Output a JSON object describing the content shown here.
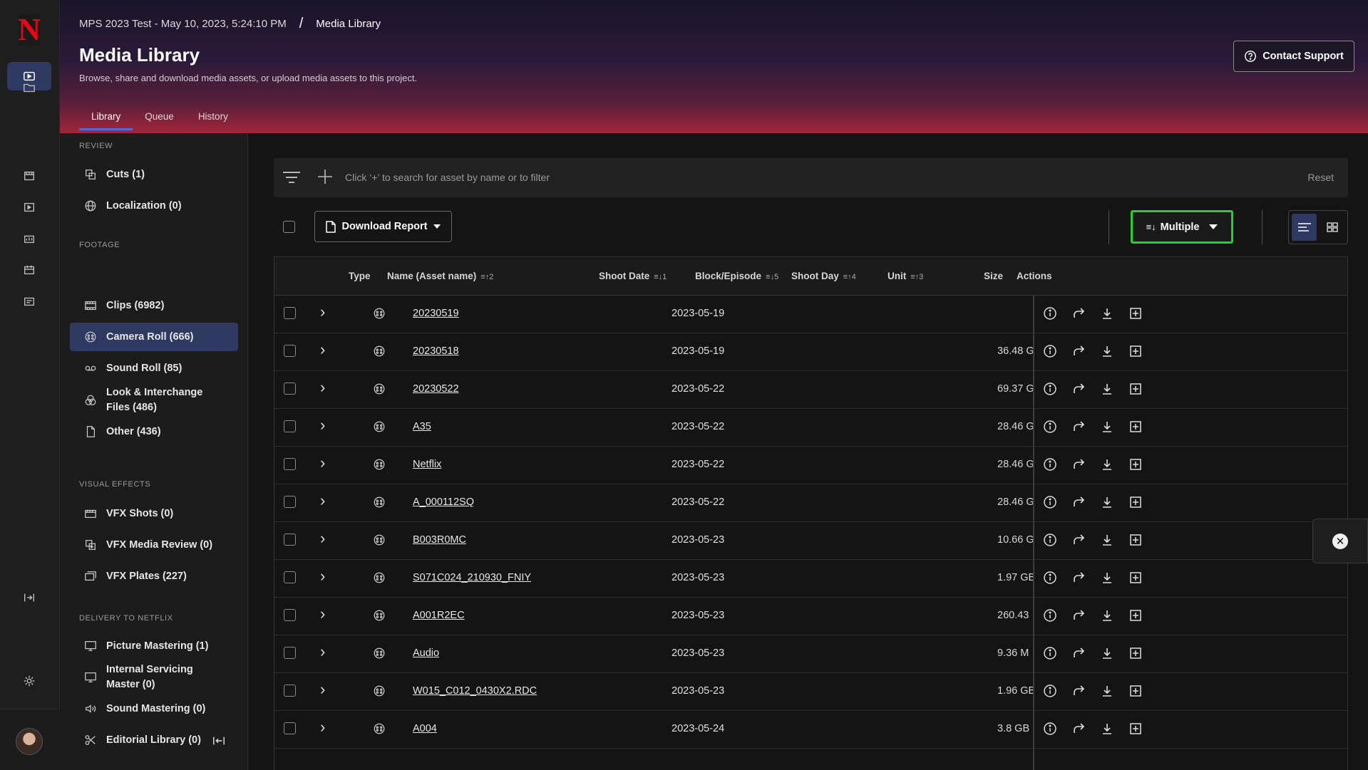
{
  "header": {
    "breadcrumb_project": "MPS 2023 Test - May 10, 2023, 5:24:10 PM",
    "breadcrumb_separator": "/",
    "breadcrumb_current": "Media Library",
    "title": "Media Library",
    "subtitle": "Browse, share and download media assets, or upload media assets to this project.",
    "contact_label": "Contact Support",
    "tabs": [
      {
        "label": "Library",
        "active": true
      },
      {
        "label": "Queue",
        "active": false
      },
      {
        "label": "History",
        "active": false
      }
    ]
  },
  "sidebar": {
    "sections": {
      "review": "REVIEW",
      "footage": "FOOTAGE",
      "vfx": "VISUAL EFFECTS",
      "delivery": "DELIVERY TO NETFLIX"
    },
    "items": [
      {
        "label": "Cuts (1)",
        "icon": "cuts-icon"
      },
      {
        "label": "Localization (0)",
        "icon": "globe-icon"
      },
      {
        "label": "Clips (6982)",
        "icon": "film-icon"
      },
      {
        "label": "Camera Roll (666)",
        "icon": "camera-roll-icon",
        "active": true
      },
      {
        "label": "Sound Roll (85)",
        "icon": "tape-icon"
      },
      {
        "label": "Look & Interchange Files (486)",
        "icon": "color-wheel-icon"
      },
      {
        "label": "Other (436)",
        "icon": "file-icon"
      },
      {
        "label": "VFX Shots (0)",
        "icon": "vfx-icon"
      },
      {
        "label": "VFX Media Review (0)",
        "icon": "review-icon"
      },
      {
        "label": "VFX Plates (227)",
        "icon": "plates-icon"
      },
      {
        "label": "Picture Mastering (1)",
        "icon": "monitor-icon"
      },
      {
        "label": "Internal Servicing Master (0)",
        "icon": "monitor-icon"
      },
      {
        "label": "Sound Mastering (0)",
        "icon": "speaker-icon"
      },
      {
        "label": "Editorial Library (0)",
        "icon": "scissors-icon"
      }
    ]
  },
  "search": {
    "placeholder": "Click ‘+’ to search for asset by name or to filter",
    "reset_label": "Reset"
  },
  "toolbar": {
    "download_label": "Download Report",
    "sort_label": "Multiple"
  },
  "table": {
    "columns": [
      {
        "label": "Type",
        "sort": ""
      },
      {
        "label": "Name (Asset name)",
        "sort": "≡↑2"
      },
      {
        "label": "Shoot Date",
        "sort": "≡↓1"
      },
      {
        "label": "Block/Episode",
        "sort": "≡↓5"
      },
      {
        "label": "Shoot Day",
        "sort": "≡↑4"
      },
      {
        "label": "Unit",
        "sort": "≡↑3"
      },
      {
        "label": "Size",
        "sort": ""
      },
      {
        "label": "Actions",
        "sort": ""
      }
    ],
    "rows": [
      {
        "name": "20230519",
        "date": "2023-05-19",
        "size": ""
      },
      {
        "name": "20230518",
        "date": "2023-05-19",
        "size": "36.48 G"
      },
      {
        "name": "20230522",
        "date": "2023-05-22",
        "size": "69.37 G"
      },
      {
        "name": "A35",
        "date": "2023-05-22",
        "size": "28.46 G"
      },
      {
        "name": "Netflix",
        "date": "2023-05-22",
        "size": "28.46 G"
      },
      {
        "name": "A_000112SQ",
        "date": "2023-05-22",
        "size": "28.46 G"
      },
      {
        "name": "B003R0MC",
        "date": "2023-05-23",
        "size": "10.66 G"
      },
      {
        "name": "S071C024_210930_FNIY",
        "date": "2023-05-23",
        "size": "1.97 GB"
      },
      {
        "name": "A001R2EC",
        "date": "2023-05-23",
        "size": "260.43"
      },
      {
        "name": "Audio",
        "date": "2023-05-23",
        "size": "9.36 M"
      },
      {
        "name": "W015_C012_0430X2.RDC",
        "date": "2023-05-23",
        "size": "1.96 GB"
      },
      {
        "name": "A004",
        "date": "2023-05-24",
        "size": "3.8 GB"
      }
    ]
  },
  "colors": {
    "accent": "#2f3a63",
    "brand": "#e50914",
    "highlight": "#22d22e"
  }
}
